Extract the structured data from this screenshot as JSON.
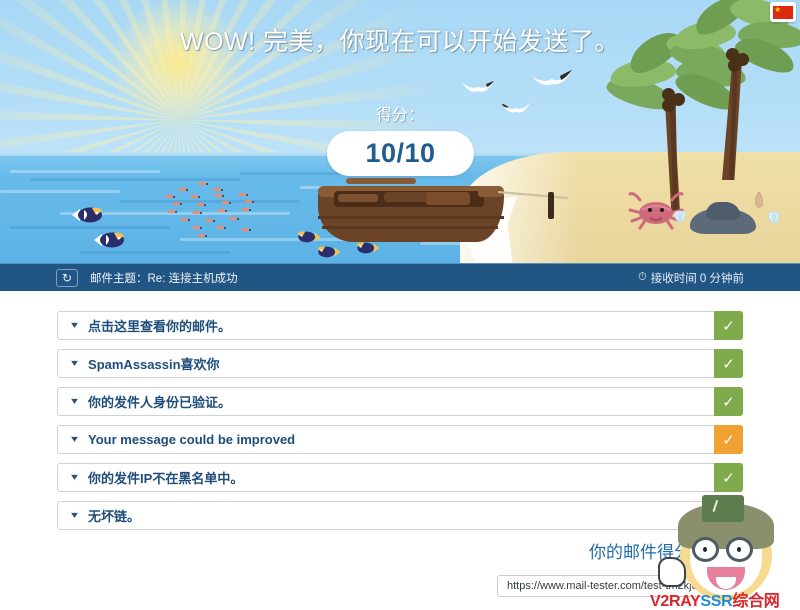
{
  "hero": {
    "title": "WOW! 完美，你现在可以开始发送了。",
    "score_label": "得分：",
    "score_value": "10/10",
    "flag_icon": "china-flag-icon",
    "sun_icon": "sun-icon",
    "colors": {
      "sky_top": "#a8d8f5",
      "sea": "#62b7e8",
      "sand": "#ecd9a0",
      "score_text": "#1f5d8c"
    }
  },
  "subject_bar": {
    "refresh_icon": "refresh-icon",
    "subject": "邮件主题：Re: 连接主机成功",
    "clock_icon": "clock-icon",
    "received": "接收时间 0 分钟前",
    "background": "#215584"
  },
  "results": {
    "items": [
      {
        "label": "点击这里查看你的邮件。",
        "status": "ok",
        "badge_icon": "check-icon",
        "color": "#7fab4d"
      },
      {
        "label": "SpamAssassin喜欢你",
        "status": "ok",
        "badge_icon": "check-icon",
        "color": "#7fab4d"
      },
      {
        "label": "你的发件人身份已验证。",
        "status": "ok",
        "badge_icon": "check-icon",
        "color": "#7fab4d"
      },
      {
        "label": "Your message could be improved",
        "status": "warn",
        "badge_icon": "check-icon",
        "color": "#f0a134"
      },
      {
        "label": "你的发件IP不在黑名单中。",
        "status": "ok",
        "badge_icon": "check-icon",
        "color": "#7fab4d"
      },
      {
        "label": "无坏链。",
        "status": "ok",
        "badge_icon": "check-icon",
        "color": "#7fab4d"
      }
    ],
    "chevron_icon": "chevron-down-icon"
  },
  "footer": {
    "score_text": "你的邮件得分: 10/10",
    "url": "https://www.mail-tester.com/test-tm2kjc5ms"
  },
  "watermark": {
    "text_1": "V2RAY",
    "text_2": "SSR",
    "text_3": "综合网",
    "avatar_icon": "cartoon-avatar-icon"
  }
}
